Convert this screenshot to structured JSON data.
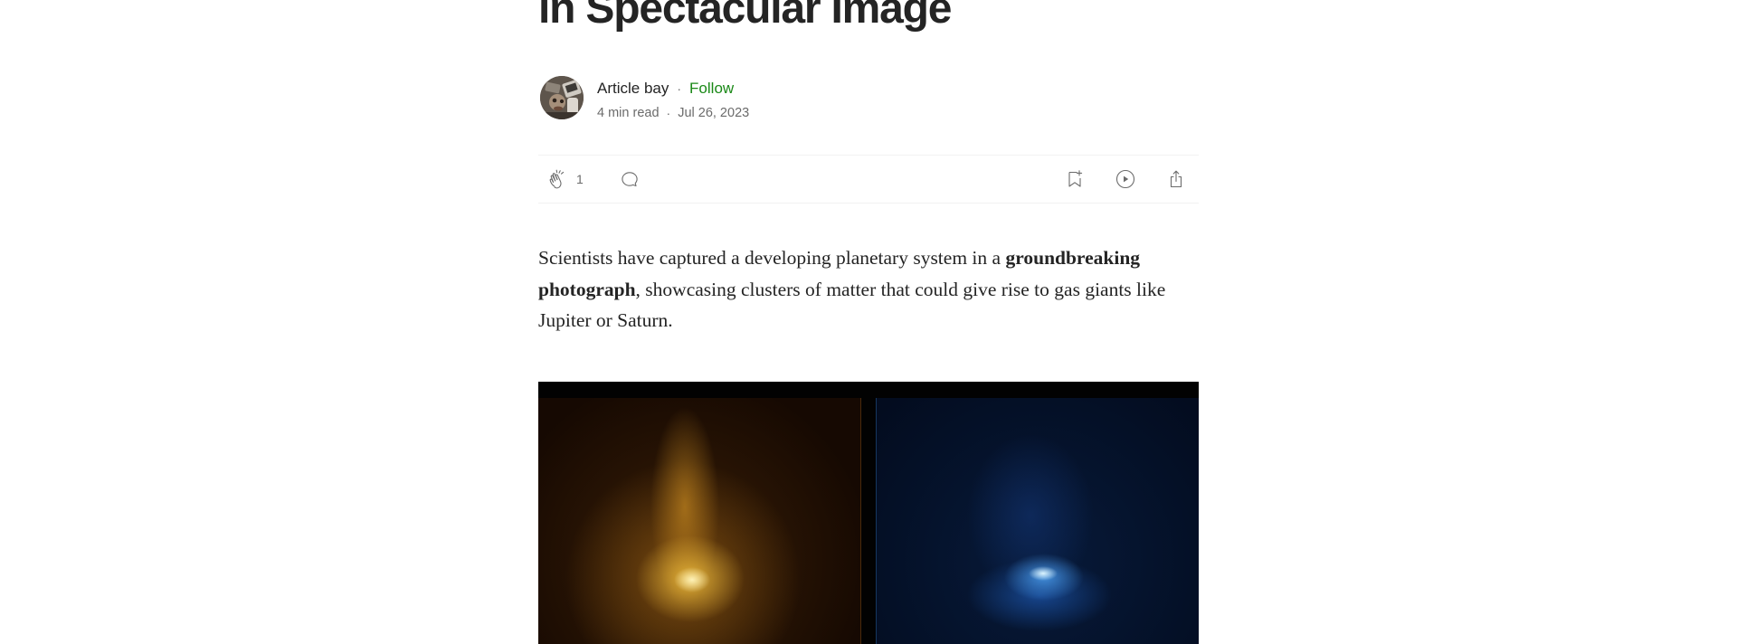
{
  "article": {
    "title_visible": "in Spectacular Image",
    "author": {
      "name": "Article bay",
      "follow_label": "Follow",
      "separator": "·"
    },
    "meta": {
      "read_time": "4 min read",
      "separator": "·",
      "date": "Jul 26, 2023"
    },
    "actions": {
      "clap_count": "1",
      "icons": [
        "clap-icon",
        "comment-icon",
        "bookmark-icon",
        "listen-icon",
        "share-icon"
      ]
    },
    "body": {
      "intro_before": "Scientists have captured a developing planetary system in a ",
      "intro_bold": "groundbreaking photograph",
      "intro_after": ", showcasing clusters of matter that could give rise to gas giants like Jupiter or Saturn."
    },
    "image": {
      "panels": [
        "yellow-nebula-panel",
        "blue-nebula-panel"
      ],
      "colors": {
        "left_glow": "#f0be3c",
        "right_glow": "#4696e6"
      }
    }
  },
  "colors": {
    "text": "#242424",
    "muted": "#6b6b6b",
    "accent_follow": "#1a8917",
    "divider": "#f2f2f2"
  }
}
